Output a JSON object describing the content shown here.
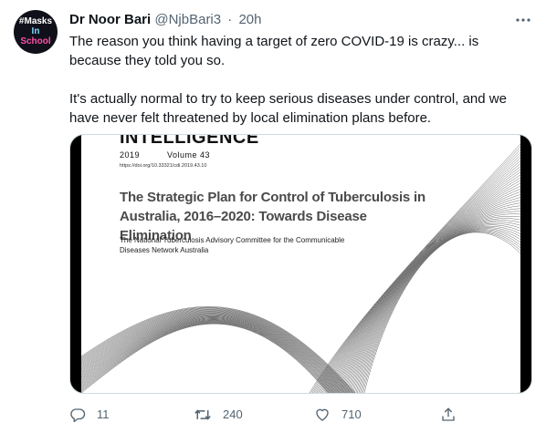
{
  "tweet": {
    "author_name": "Dr Noor Bari",
    "author_handle": "@NjbBari3",
    "separator": "·",
    "time": "20h",
    "avatar": {
      "line1": "#Masks",
      "line2": "In",
      "line3": "School"
    },
    "paragraphs": [
      "The reason you think having a target of zero COVID-19 is crazy... is because they told you so.",
      "It's actually normal to try to keep serious diseases under control, and we have never felt threatened by local elimination plans before."
    ],
    "media": {
      "masthead": "INTELLIGENCE",
      "year": "2019",
      "volume": "Volume 43",
      "doi": "https://doi.org/10.33321/cdi.2019.43.10",
      "title": "The Strategic Plan for Control of Tuberculosis in Australia, 2016–2020: Towards Disease Elimination",
      "committee": "The National Tuberculosis Advisory Committee for the Communicable Diseases Network Australia"
    },
    "actions": {
      "reply_count": "11",
      "retweet_count": "240",
      "like_count": "710"
    }
  },
  "colors": {
    "text": "#0f1419",
    "secondary": "#536471",
    "border": "#cfd9de"
  },
  "icons": [
    "more-icon",
    "reply-icon",
    "retweet-icon",
    "like-icon",
    "share-icon"
  ]
}
